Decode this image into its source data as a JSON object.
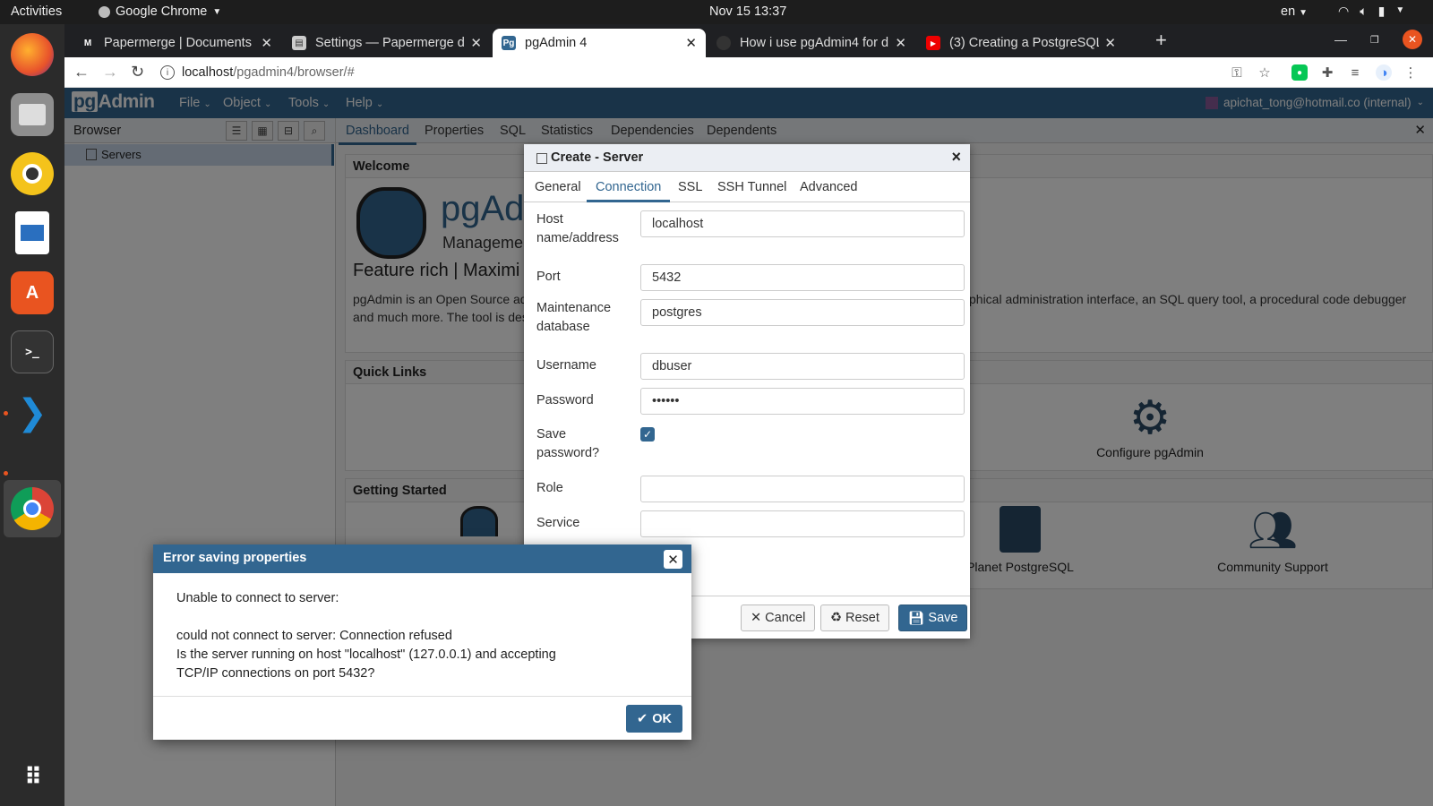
{
  "topbar": {
    "activities": "Activities",
    "app_name": "Google Chrome",
    "clock": "Nov 15  13:37",
    "lang": "en"
  },
  "chrome": {
    "tabs": [
      {
        "title": "Papermerge | Documents",
        "favicon": "papermerge-icon"
      },
      {
        "title": "Settings — Papermerge d",
        "favicon": "doc-icon"
      },
      {
        "title": "pgAdmin 4",
        "favicon": "pgadmin-icon"
      },
      {
        "title": "How i use pgAdmin4 for d",
        "favicon": "github-icon"
      },
      {
        "title": "(3) Creating a PostgreSQL",
        "favicon": "youtube-icon"
      }
    ],
    "url_host": "localhost",
    "url_path": "/pgadmin4/browser/#"
  },
  "pgadmin": {
    "logo_pg": "pg",
    "logo_rest": "Admin",
    "menus": [
      "File",
      "Object",
      "Tools",
      "Help"
    ],
    "user": "apichat_tong@hotmail.co (internal)"
  },
  "browser": {
    "title": "Browser",
    "tree": [
      {
        "label": "Servers"
      }
    ]
  },
  "main": {
    "tabs": [
      "Dashboard",
      "Properties",
      "SQL",
      "Statistics",
      "Dependencies",
      "Dependents"
    ],
    "welcome": {
      "header": "Welcome",
      "title": "pgAd",
      "subtitle": "Manageme",
      "feature": "Feature rich | Maximi",
      "desc_left_1": "pgAdmin is an Open Source adı",
      "desc_left_2": "and much more. The tool is des",
      "desc_right": "phical administration interface, an SQL query tool, a procedural code debugger"
    },
    "quick_links": {
      "header": "Quick Links",
      "configure": "Configure pgAdmin"
    },
    "getting_started": {
      "header": "Getting Started",
      "planet": "Planet PostgreSQL",
      "community": "Community Support"
    }
  },
  "dialog": {
    "title": "Create - Server",
    "tabs": [
      "General",
      "Connection",
      "SSL",
      "SSH Tunnel",
      "Advanced"
    ],
    "active_tab": "Connection",
    "fields": {
      "host": {
        "label": "Host name/address",
        "value": "localhost"
      },
      "port": {
        "label": "Port",
        "value": "5432"
      },
      "maint_db": {
        "label": "Maintenance database",
        "value": "postgres"
      },
      "username": {
        "label": "Username",
        "value": "dbuser"
      },
      "password": {
        "label": "Password",
        "value": "••••••"
      },
      "save_password": {
        "label": "Save password?",
        "checked": true
      },
      "role": {
        "label": "Role",
        "value": ""
      },
      "service": {
        "label": "Service",
        "value": ""
      }
    },
    "buttons": {
      "cancel": "Cancel",
      "reset": "Reset",
      "save": "Save"
    }
  },
  "error": {
    "title": "Error saving properties",
    "line1": "Unable to connect to server:",
    "line2": "could not connect to server: Connection refused",
    "line3": "Is the server running on host \"localhost\" (127.0.0.1) and accepting",
    "line4": "TCP/IP connections on port 5432?",
    "ok": "OK"
  },
  "colors": {
    "pgadmin_blue": "#326690",
    "chrome_dark": "#1f2023"
  }
}
